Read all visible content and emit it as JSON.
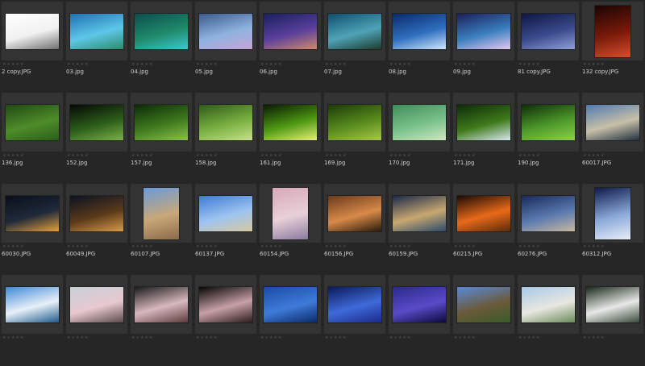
{
  "ui": {
    "star_glyph": "★★★★★"
  },
  "thumbnails": [
    {
      "name": "2 copy.JPG",
      "desc": "white-mosque-sketch",
      "orientation": "landscape",
      "colors": [
        "#ffffff",
        "#f1f1f1",
        "#6f6f6f"
      ]
    },
    {
      "name": "03.jpg",
      "desc": "fantasy-blue-islands",
      "orientation": "landscape",
      "colors": [
        "#1f6fb0",
        "#5ec7e8",
        "#2c8c6a"
      ]
    },
    {
      "name": "04.jpg",
      "desc": "green-mountain-lake",
      "orientation": "landscape",
      "colors": [
        "#0c4e4e",
        "#1f8a6a",
        "#3dc7d0"
      ]
    },
    {
      "name": "05.jpg",
      "desc": "fantasy-fairy",
      "orientation": "landscape",
      "colors": [
        "#3a5a8c",
        "#8fb3df",
        "#c7a3d8"
      ]
    },
    {
      "name": "06.jpg",
      "desc": "night-sky-aurora",
      "orientation": "landscape",
      "colors": [
        "#1a1f5c",
        "#5a3f9c",
        "#d08a6a"
      ]
    },
    {
      "name": "07.jpg",
      "desc": "tree-over-sea",
      "orientation": "landscape",
      "colors": [
        "#0f4e6e",
        "#4fa3b8",
        "#1d3c2c"
      ]
    },
    {
      "name": "08.jpg",
      "desc": "blue-horizon-glow",
      "orientation": "landscape",
      "colors": [
        "#0a2a6a",
        "#2f6fbf",
        "#cfe6ff"
      ]
    },
    {
      "name": "09.jpg",
      "desc": "fantasy-night-blossoms",
      "orientation": "landscape",
      "colors": [
        "#1c1f5a",
        "#3a7fbf",
        "#e6c8f0"
      ]
    },
    {
      "name": "81 copy.JPG",
      "desc": "dark-blue-field",
      "orientation": "landscape",
      "colors": [
        "#0e1642",
        "#3a4a8c",
        "#8fa0d8"
      ]
    },
    {
      "name": "132 copy.JPG",
      "desc": "red-glowing-symbol",
      "orientation": "portrait",
      "colors": [
        "#1a0502",
        "#7a1a0a",
        "#d4502a"
      ]
    },
    {
      "name": "136.jpg",
      "desc": "green-leaf-texture",
      "orientation": "landscape",
      "colors": [
        "#1f4a12",
        "#4f8c2a",
        "#2a5e18"
      ]
    },
    {
      "name": "152.jpg",
      "desc": "green-bushes-dark",
      "orientation": "landscape",
      "colors": [
        "#050805",
        "#2c5e1a",
        "#7ab04a"
      ]
    },
    {
      "name": "157.jpg",
      "desc": "fern-leaves",
      "orientation": "landscape",
      "colors": [
        "#0c2a08",
        "#3f7a1e",
        "#8bc24a"
      ]
    },
    {
      "name": "158.jpg",
      "desc": "green-sprouts",
      "orientation": "landscape",
      "colors": [
        "#2f5a1a",
        "#7ab040",
        "#c6e28c"
      ]
    },
    {
      "name": "161.jpg",
      "desc": "green-bokeh-flower",
      "orientation": "landscape",
      "colors": [
        "#0a1a04",
        "#4f9a12",
        "#e6f07a"
      ]
    },
    {
      "name": "169.jpg",
      "desc": "grass-blades",
      "orientation": "landscape",
      "colors": [
        "#1c3a08",
        "#5a8c1e",
        "#a8c84a"
      ]
    },
    {
      "name": "170.jpg",
      "desc": "pale-green-leaves",
      "orientation": "landscape",
      "colors": [
        "#3f8c5a",
        "#7ac28c",
        "#cfe8c0"
      ]
    },
    {
      "name": "171.jpg",
      "desc": "dewdrop-leaf",
      "orientation": "landscape",
      "colors": [
        "#0e2a0a",
        "#3f7a1a",
        "#d8e8f0"
      ]
    },
    {
      "name": "190.jpg",
      "desc": "big-green-leaf",
      "orientation": "landscape",
      "colors": [
        "#0e2e0a",
        "#4f9a2a",
        "#8cd04a"
      ]
    },
    {
      "name": "60017.JPG",
      "desc": "palace-reflection",
      "orientation": "landscape",
      "colors": [
        "#4f7ab0",
        "#c8c0a8",
        "#1f3040"
      ]
    },
    {
      "name": "60030.JPG",
      "desc": "night-palace-lights",
      "orientation": "landscape",
      "colors": [
        "#0a0e1a",
        "#1f2a3a",
        "#e8a03a"
      ]
    },
    {
      "name": "60049.JPG",
      "desc": "night-plaza",
      "orientation": "landscape",
      "colors": [
        "#0c1224",
        "#5a3a1a",
        "#d89a4a"
      ]
    },
    {
      "name": "60107.JPG",
      "desc": "plaza-colonnade",
      "orientation": "portrait",
      "colors": [
        "#6a9ad8",
        "#c8a878",
        "#8a6a4a"
      ]
    },
    {
      "name": "60137.JPG",
      "desc": "parthenon",
      "orientation": "landscape",
      "colors": [
        "#3f7ad8",
        "#9ec4f0",
        "#d8c8a0"
      ]
    },
    {
      "name": "60154.JPG",
      "desc": "mosque-pink-sky",
      "orientation": "portrait",
      "colors": [
        "#d8a8b8",
        "#e8d0d8",
        "#8a7aa0"
      ]
    },
    {
      "name": "60156.JPG",
      "desc": "sunset-boat",
      "orientation": "landscape",
      "colors": [
        "#6a3a1a",
        "#d88a4a",
        "#2a1a0a"
      ]
    },
    {
      "name": "60159.JPG",
      "desc": "waterfront-town",
      "orientation": "landscape",
      "colors": [
        "#1a2a4a",
        "#c8a870",
        "#2a4a6a"
      ]
    },
    {
      "name": "60215.JPG",
      "desc": "orange-sunset-sea",
      "orientation": "landscape",
      "colors": [
        "#1a0a04",
        "#e86a1a",
        "#5a2a0a"
      ]
    },
    {
      "name": "60276.JPG",
      "desc": "city-square-statue",
      "orientation": "landscape",
      "colors": [
        "#1a2a5a",
        "#5a7ab0",
        "#c8b8a0"
      ]
    },
    {
      "name": "60312.JPG",
      "desc": "snow-dunes-night",
      "orientation": "portrait",
      "colors": [
        "#0e1a4a",
        "#8aa8d8",
        "#e8eef8"
      ]
    },
    {
      "name": "",
      "desc": "mountain-lake",
      "orientation": "landscape",
      "colors": [
        "#3f8ad8",
        "#e8f0f8",
        "#1f5a8a"
      ]
    },
    {
      "name": "",
      "desc": "cherry-blossom-branch",
      "orientation": "landscape",
      "colors": [
        "#c8d0d8",
        "#e8c8d0",
        "#5a4a4a"
      ]
    },
    {
      "name": "",
      "desc": "blossoms-dark",
      "orientation": "landscape",
      "colors": [
        "#1a1a1a",
        "#d8b8c0",
        "#5a3a3a"
      ]
    },
    {
      "name": "",
      "desc": "blossoms-black-bg",
      "orientation": "landscape",
      "colors": [
        "#050505",
        "#c8a0a8",
        "#2a1a1a"
      ]
    },
    {
      "name": "",
      "desc": "blue-night-harbor",
      "orientation": "landscape",
      "colors": [
        "#1a4aa8",
        "#3f7ad8",
        "#0a2a6a"
      ]
    },
    {
      "name": "",
      "desc": "bridge-night",
      "orientation": "landscape",
      "colors": [
        "#0a1a5a",
        "#3f6ad8",
        "#1a2a8a"
      ]
    },
    {
      "name": "",
      "desc": "city-skyline-night",
      "orientation": "landscape",
      "colors": [
        "#2a2a8a",
        "#5a4ac8",
        "#0a0a3a"
      ]
    },
    {
      "name": "",
      "desc": "brick-building",
      "orientation": "landscape",
      "colors": [
        "#5a8ad8",
        "#6a5a3a",
        "#3a5a2a"
      ]
    },
    {
      "name": "",
      "desc": "white-palace",
      "orientation": "landscape",
      "colors": [
        "#a8c8e8",
        "#e8e8e0",
        "#6a8a5a"
      ]
    },
    {
      "name": "",
      "desc": "white-flowers-dark",
      "orientation": "landscape",
      "colors": [
        "#1a2a1a",
        "#e8e8e8",
        "#3a4a3a"
      ]
    }
  ]
}
